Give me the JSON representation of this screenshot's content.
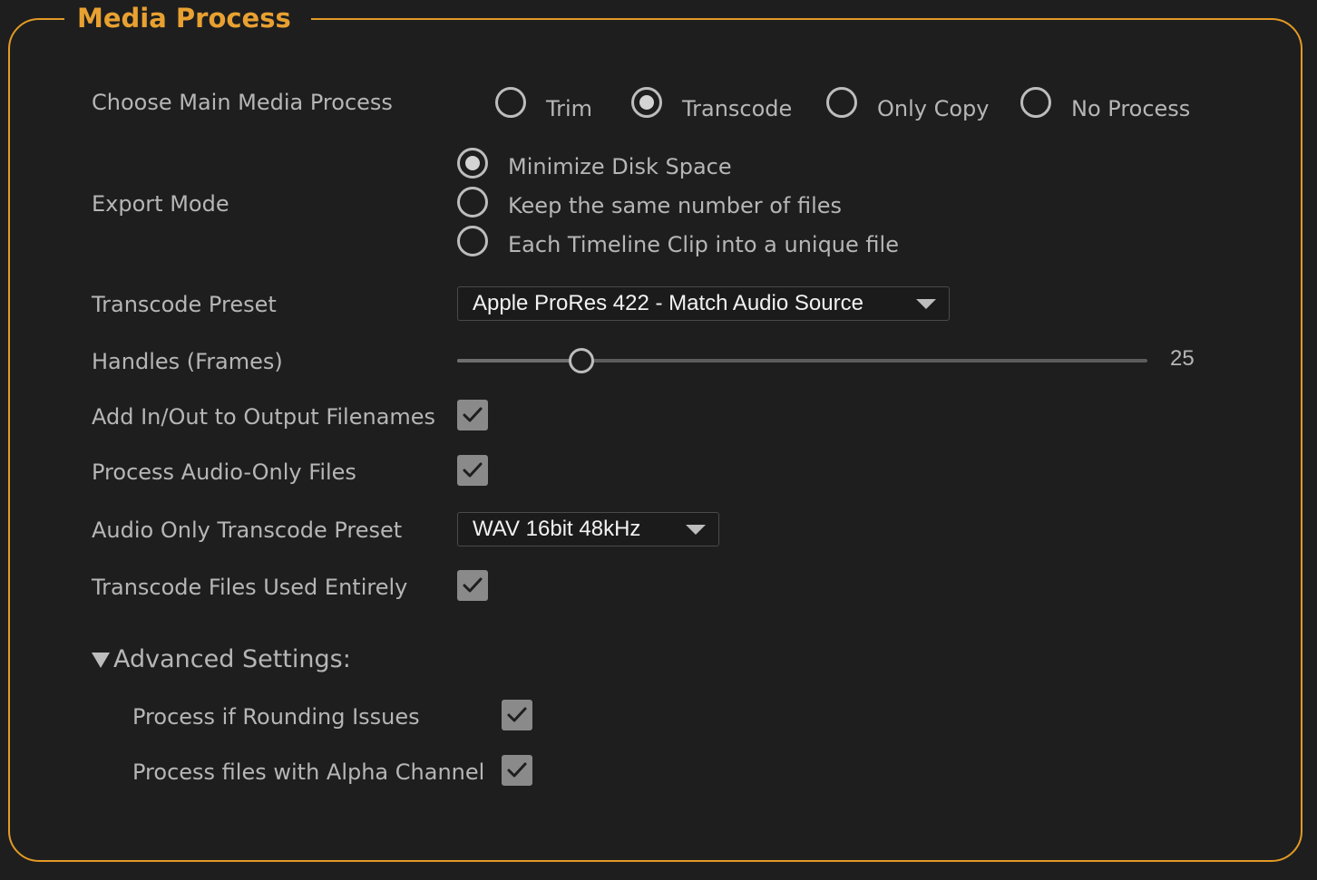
{
  "panel": {
    "title": "Media Process"
  },
  "main_process": {
    "label": "Choose Main Media Process",
    "options": [
      {
        "label": "Trim",
        "selected": false
      },
      {
        "label": "Transcode",
        "selected": true
      },
      {
        "label": "Only Copy",
        "selected": false
      },
      {
        "label": "No Process",
        "selected": false
      }
    ]
  },
  "export_mode": {
    "label": "Export Mode",
    "options": [
      {
        "label": "Minimize Disk Space",
        "selected": true
      },
      {
        "label": "Keep the same number of files",
        "selected": false
      },
      {
        "label": "Each Timeline Clip into a unique file",
        "selected": false
      }
    ]
  },
  "transcode_preset": {
    "label": "Transcode Preset",
    "value": "Apple ProRes 422 - Match Audio Source"
  },
  "handles": {
    "label": "Handles (Frames)",
    "value": "25",
    "fraction": 0.18
  },
  "add_in_out": {
    "label": "Add In/Out to Output Filenames",
    "checked": true
  },
  "process_audio_only": {
    "label": "Process Audio-Only Files",
    "checked": true
  },
  "audio_preset": {
    "label": "Audio Only Transcode Preset",
    "value": "WAV 16bit 48kHz"
  },
  "transcode_entirely": {
    "label": "Transcode Files Used Entirely",
    "checked": true
  },
  "advanced": {
    "label": "Advanced Settings:",
    "expanded": true,
    "rounding": {
      "label": "Process if Rounding Issues",
      "checked": true
    },
    "alpha": {
      "label": "Process files with Alpha Channel",
      "checked": true
    }
  },
  "colors": {
    "accent": "#e39a26",
    "title": "#e8a131",
    "background": "#1e1e1e",
    "text": "#b6b6b6",
    "checkbox": "#8a8a8a"
  }
}
